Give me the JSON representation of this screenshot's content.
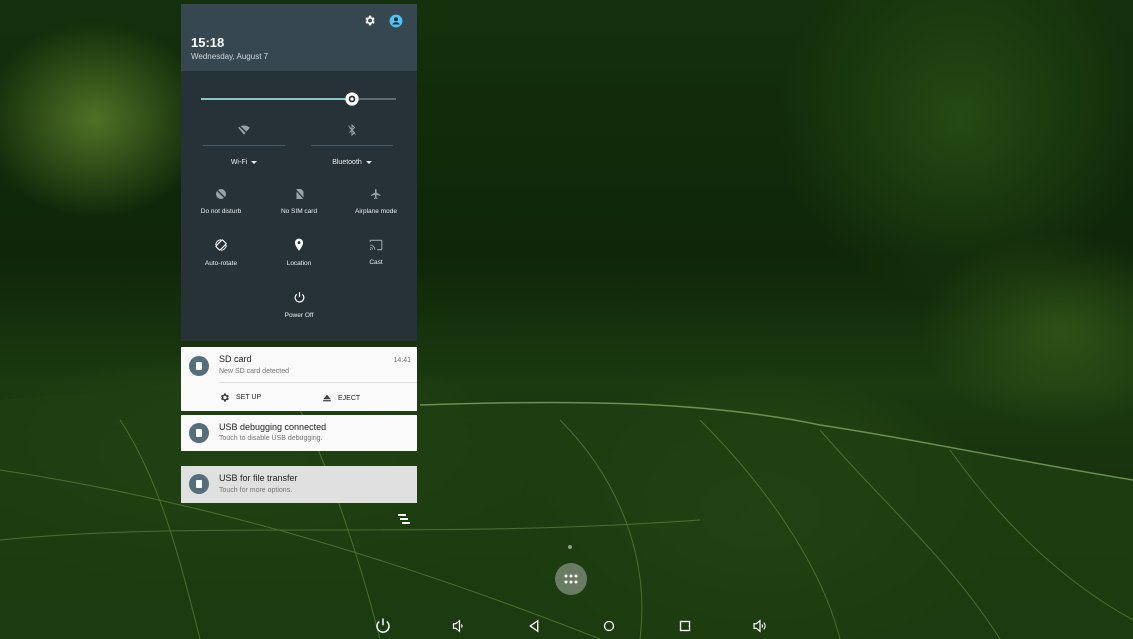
{
  "status": {
    "time": "15:18",
    "date": "Wednesday, August 7"
  },
  "header_icons": [
    "settings-icon",
    "account-icon"
  ],
  "brightness": {
    "level": 0.77
  },
  "quick_settings": {
    "wifi_label": "Wi-Fi",
    "bluetooth_label": "Bluetooth",
    "tiles": [
      {
        "label": "Do not disturb",
        "icon": "do-not-disturb-icon"
      },
      {
        "label": "No SIM card",
        "icon": "no-sim-icon"
      },
      {
        "label": "Airplane mode",
        "icon": "airplane-icon"
      },
      {
        "label": "Auto-rotate",
        "icon": "auto-rotate-icon"
      },
      {
        "label": "Location",
        "icon": "location-icon"
      },
      {
        "label": "Cast",
        "icon": "cast-icon"
      },
      {
        "label": "Power Off",
        "icon": "power-icon"
      }
    ]
  },
  "notifications": [
    {
      "title": "SD card",
      "subtitle": "New SD card detected",
      "time": "14:41",
      "actions": [
        "SET UP",
        "EJECT"
      ]
    },
    {
      "title": "USB debugging connected",
      "subtitle": "Touch to disable USB debugging."
    },
    {
      "title": "USB for file transfer",
      "subtitle": "Touch for more options."
    }
  ],
  "navbar": [
    "power-icon",
    "volume-down-icon",
    "back-icon",
    "home-icon",
    "recents-icon",
    "volume-up-icon"
  ],
  "colors": {
    "shade_bg": "#263238",
    "shade_header": "#37474f",
    "accent": "#80cbc4",
    "account_accent": "#4fc3f7"
  }
}
